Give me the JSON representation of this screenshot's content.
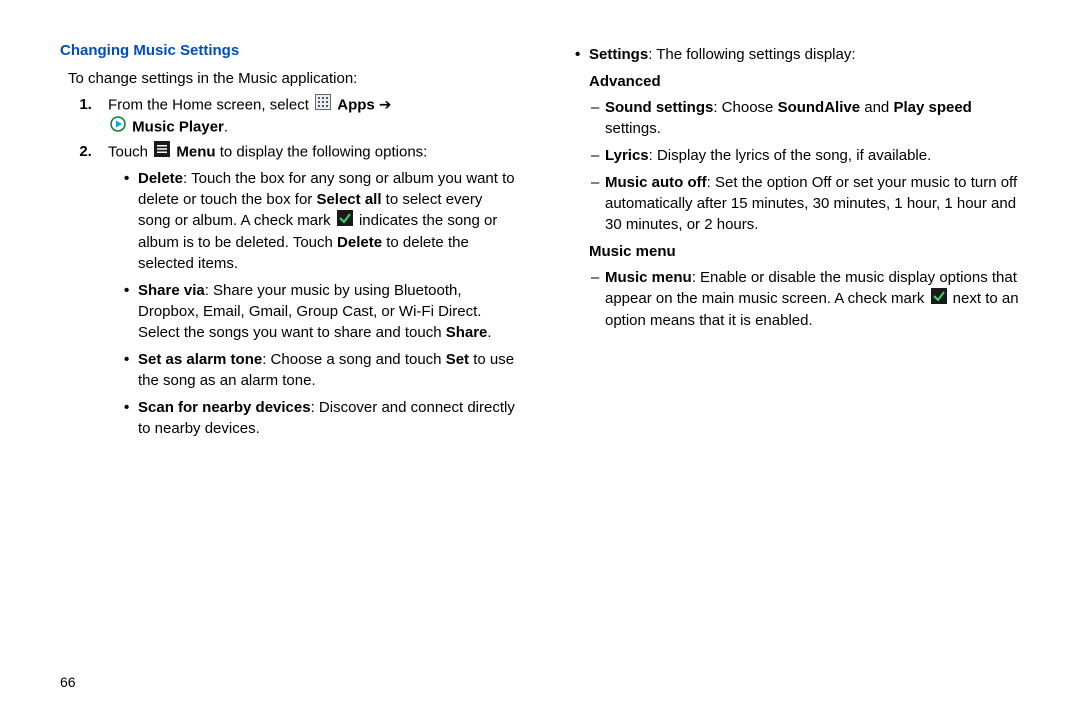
{
  "pageNumber": "66",
  "title": "Changing Music Settings",
  "intro": "To change settings in the Music application:",
  "step1_a": "From the Home screen, select ",
  "step1_apps": "Apps",
  "step1_arrow": " ➔",
  "step1_music": "Music Player",
  "step1_dot": ".",
  "step2_a": "Touch ",
  "step2_menu": "Menu",
  "step2_b": " to display the following options:",
  "del_1": "Delete",
  "del_2": ": Touch the box for any song or album you want to delete or touch the box for ",
  "del_3": "Select all",
  "del_4": " to select every song or album. A check mark ",
  "del_5": " indicates the song or album is to be deleted. Touch ",
  "del_6": "Delete",
  "del_7": " to delete the selected items.",
  "share_1": "Share via",
  "share_2": ": Share your music by using Bluetooth, Dropbox, Email, Gmail, Group Cast, or Wi-Fi Direct. Select the songs you want to share and touch ",
  "share_3": "Share",
  "share_4": ".",
  "alarm_1": "Set as alarm tone",
  "alarm_2": ": Choose a song and touch ",
  "alarm_3": "Set",
  "alarm_4": " to use the song as an alarm tone.",
  "scan_1": "Scan for nearby devices",
  "scan_2": ": Discover and connect directly to nearby devices.",
  "settings_1": "Settings",
  "settings_2": ": The following settings display:",
  "advanced_head": "Advanced",
  "snd_1": "Sound settings",
  "snd_2": ": Choose ",
  "snd_3": "SoundAlive",
  "snd_4": " and ",
  "snd_5": "Play speed",
  "snd_6": " settings.",
  "lyr_1": "Lyrics",
  "lyr_2": ": Display the lyrics of the song, if available.",
  "auto_1": "Music auto off",
  "auto_2": ": Set the option Off or set your music to turn off automatically after 15 minutes, 30 minutes, 1 hour, 1 hour and 30 minutes, or 2 hours.",
  "menu_head": "Music menu",
  "mm_1": "Music menu",
  "mm_2": ": Enable or disable the music display options that appear on the main music screen. A check mark ",
  "mm_3": " next to an option means that it is enabled."
}
